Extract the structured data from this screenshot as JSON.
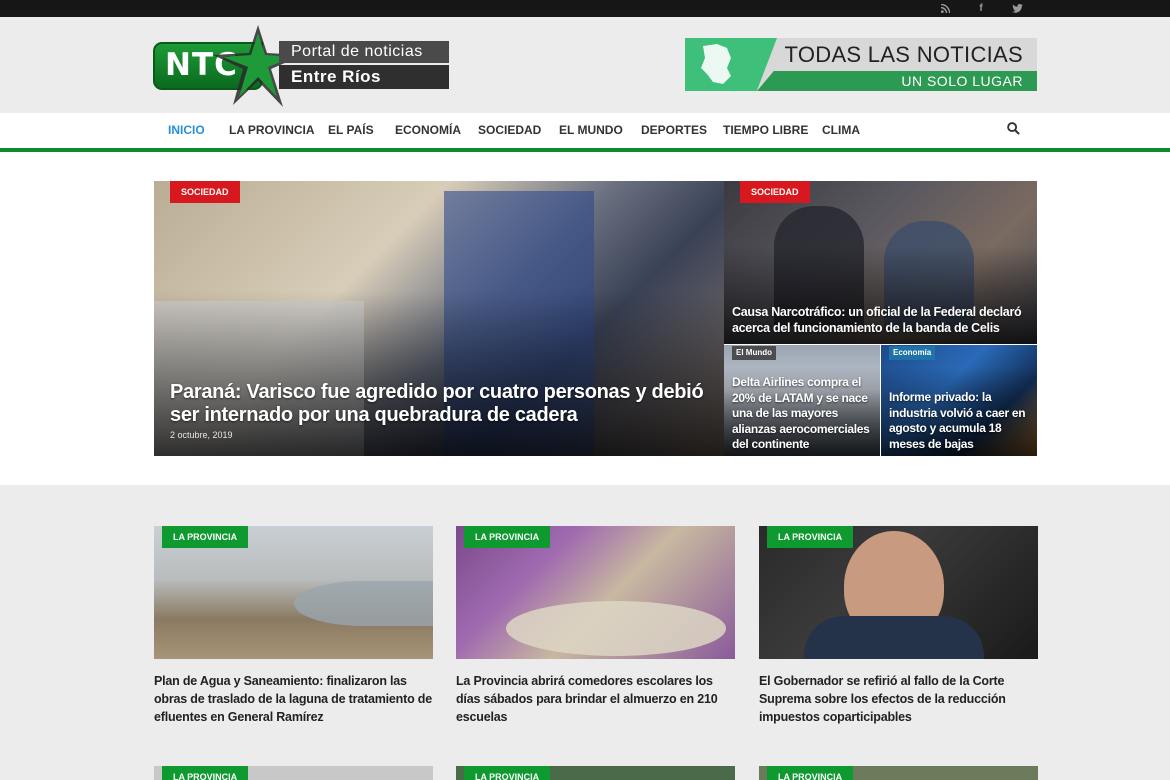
{
  "social": {
    "rss": "rss-icon",
    "facebook": "f",
    "twitter": "twitter-icon"
  },
  "logo": {
    "abbr": "NTC",
    "line1": "Portal de noticias",
    "line2": "Entre Ríos"
  },
  "banner": {
    "line1": "TODAS LAS NOTICIAS",
    "line2": "UN SOLO LUGAR"
  },
  "nav": {
    "items": [
      {
        "label": "INICIO"
      },
      {
        "label": "LA PROVINCIA"
      },
      {
        "label": "EL PAÍS"
      },
      {
        "label": "ECONOMÍA"
      },
      {
        "label": "SOCIEDAD"
      },
      {
        "label": "EL MUNDO"
      },
      {
        "label": "DEPORTES"
      },
      {
        "label": "TIEMPO LIBRE"
      },
      {
        "label": "CLIMA"
      }
    ]
  },
  "hero": {
    "main": {
      "tag": "SOCIEDAD",
      "title": "Paraná: Varisco fue agredido por cuatro personas y debió ser internado por una quebradura de cadera",
      "date": "2 octubre, 2019"
    },
    "top_right": {
      "tag": "SOCIEDAD",
      "title": "Causa Narcotráfico: un oficial de la Federal declaró acerca del funcionamiento de la banda de Celis"
    },
    "bottom_left": {
      "tag": "El Mundo",
      "title": "Delta Airlines compra el 20% de LATAM y se nace una de las mayores alianzas aerocomerciales del continente"
    },
    "bottom_right": {
      "tag": "Economía",
      "title": "Informe privado: la industria volvió a caer en agosto y acumula 18 meses de bajas"
    }
  },
  "cards": [
    {
      "tag": "LA PROVINCIA",
      "headline": "Plan de Agua y Saneamiento: finalizaron las obras de traslado de la laguna de tratamiento de efluentes en General Ramírez"
    },
    {
      "tag": "LA PROVINCIA",
      "headline": "La Provincia abrirá comedores escolares los días sábados para brindar el almuerzo en 210 escuelas"
    },
    {
      "tag": "LA PROVINCIA",
      "headline": "El Gobernador se refirió al fallo de la Corte Suprema sobre los efectos de la reducción impuestos coparticipables"
    }
  ],
  "cards_row2": [
    {
      "tag": "LA PROVINCIA"
    },
    {
      "tag": "LA PROVINCIA"
    },
    {
      "tag": "LA PROVINCIA"
    }
  ],
  "colors": {
    "accent_green": "#0e8a2c",
    "tag_red": "#d7191f",
    "nav_active": "#2a8fd8"
  }
}
